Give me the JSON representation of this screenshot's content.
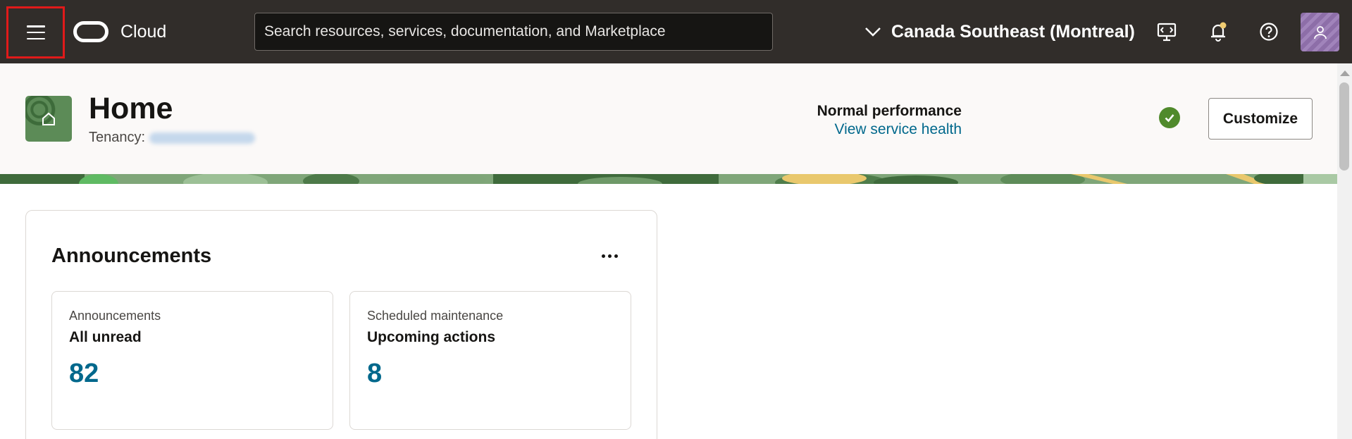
{
  "topbar": {
    "brand": "Cloud",
    "search_placeholder": "Search resources, services, documentation, and Marketplace",
    "region_label": "Canada Southeast (Montreal)"
  },
  "header": {
    "title": "Home",
    "tenancy_label": "Tenancy:",
    "performance_status": "Normal performance",
    "performance_link": "View service health",
    "customize_label": "Customize"
  },
  "announcements": {
    "title": "Announcements",
    "tiles": [
      {
        "subtitle": "Announcements",
        "heading": "All unread",
        "count": "82"
      },
      {
        "subtitle": "Scheduled maintenance",
        "heading": "Upcoming actions",
        "count": "8"
      }
    ]
  },
  "colors": {
    "topbar_bg": "#312d2a",
    "accent_link": "#00688c",
    "status_ok": "#508a2c",
    "highlight_border": "#e01a1a"
  }
}
